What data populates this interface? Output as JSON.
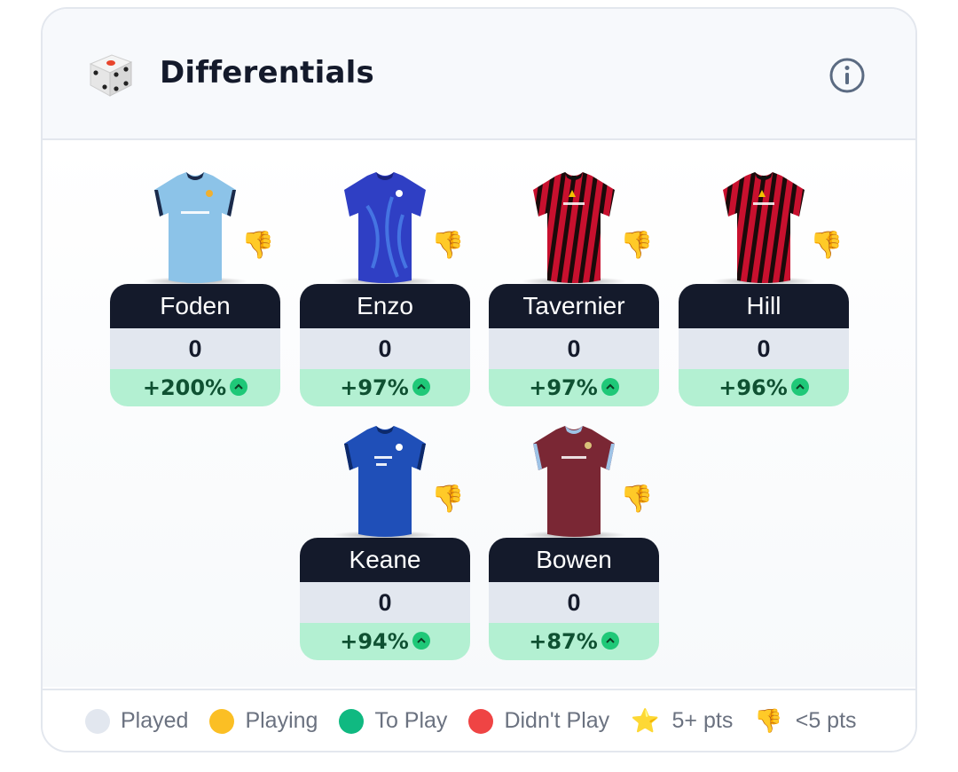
{
  "header": {
    "title": "Differentials",
    "dice_icon": "dice-icon",
    "info_icon": "info-icon"
  },
  "players": [
    {
      "name": "Foden",
      "points": "0",
      "delta": "+200%",
      "shirt": "man-city",
      "rating_icon": "thumbs-down-icon"
    },
    {
      "name": "Enzo",
      "points": "0",
      "delta": "+97%",
      "shirt": "chelsea",
      "rating_icon": "thumbs-down-icon"
    },
    {
      "name": "Tavernier",
      "points": "0",
      "delta": "+97%",
      "shirt": "bournemouth",
      "rating_icon": "thumbs-down-icon"
    },
    {
      "name": "Hill",
      "points": "0",
      "delta": "+96%",
      "shirt": "bournemouth",
      "rating_icon": "thumbs-down-icon"
    },
    {
      "name": "Keane",
      "points": "0",
      "delta": "+94%",
      "shirt": "everton",
      "rating_icon": "thumbs-down-icon"
    },
    {
      "name": "Bowen",
      "points": "0",
      "delta": "+87%",
      "shirt": "west-ham",
      "rating_icon": "thumbs-down-icon"
    }
  ],
  "legend": [
    {
      "label": "Played",
      "icon": "dot",
      "color": "#e2e7ef"
    },
    {
      "label": "Playing",
      "icon": "dot",
      "color": "#fbbf24"
    },
    {
      "label": "To Play",
      "icon": "dot",
      "color": "#10b981"
    },
    {
      "label": "Didn't Play",
      "icon": "dot",
      "color": "#ef4444"
    },
    {
      "label": "5+ pts",
      "icon": "star-icon"
    },
    {
      "label": "<5 pts",
      "icon": "thumbs-down-icon"
    }
  ],
  "colors": {
    "name_bg": "#141a2b",
    "points_bg": "#e2e7ef",
    "delta_bg": "#b3f0d2",
    "delta_text": "#0f5132",
    "up_icon": "#1fc878"
  }
}
